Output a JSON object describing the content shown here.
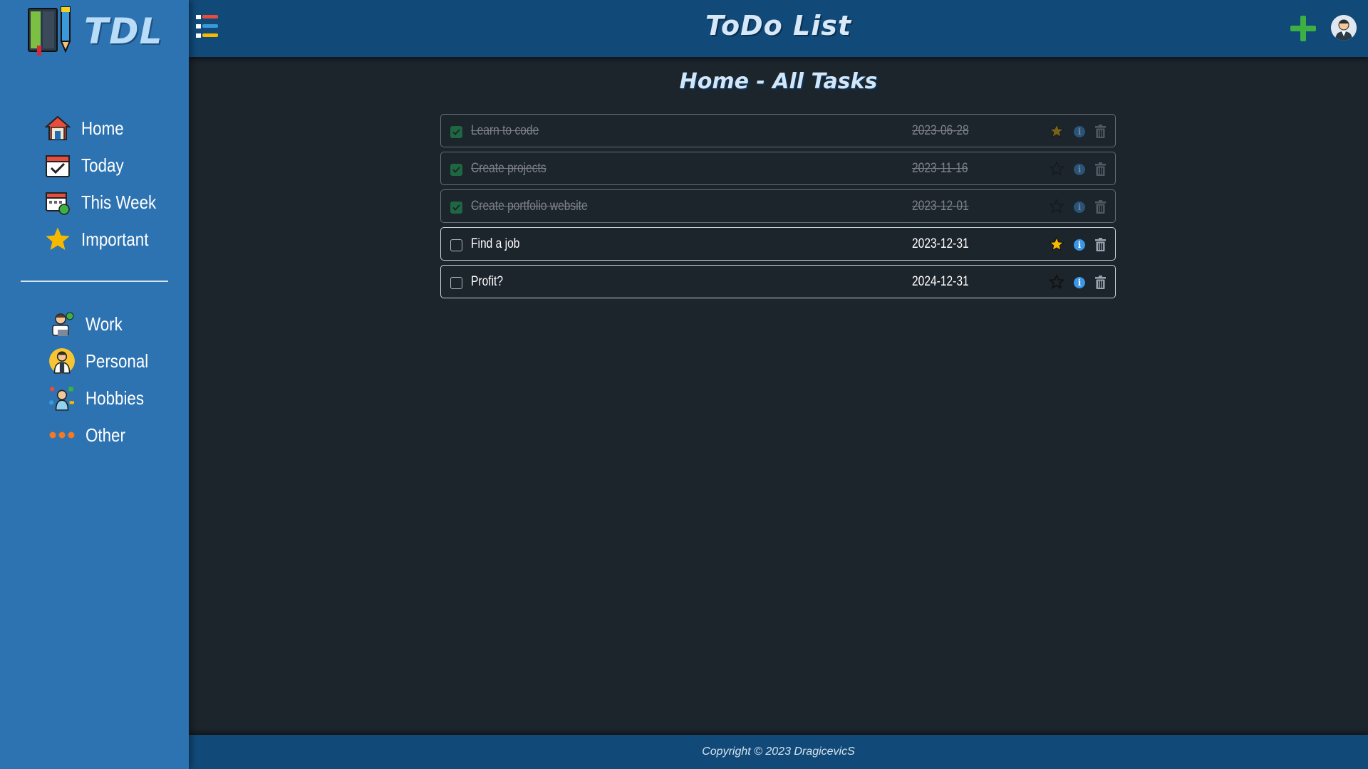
{
  "sidebar": {
    "logo_text": "TDL",
    "nav": [
      {
        "label": "Home",
        "icon": "house-icon"
      },
      {
        "label": "Today",
        "icon": "calendar-check-icon"
      },
      {
        "label": "This Week",
        "icon": "calendar-week-icon"
      },
      {
        "label": "Important",
        "icon": "star-icon"
      }
    ],
    "projects": [
      {
        "label": "Work",
        "icon": "worker-icon"
      },
      {
        "label": "Personal",
        "icon": "person-icon"
      },
      {
        "label": "Hobbies",
        "icon": "hobbies-icon"
      },
      {
        "label": "Other",
        "icon": "dots-icon"
      }
    ]
  },
  "header": {
    "title": "ToDo List"
  },
  "main": {
    "page_title": "Home - All Tasks",
    "tasks": [
      {
        "name": "Learn to code",
        "date": "2023-06-28",
        "done": true,
        "important": true
      },
      {
        "name": "Create projects",
        "date": "2023-11-16",
        "done": true,
        "important": false
      },
      {
        "name": "Create portfolio website",
        "date": "2023-12-01",
        "done": true,
        "important": false
      },
      {
        "name": "Find a job",
        "date": "2023-12-31",
        "done": false,
        "important": true
      },
      {
        "name": "Profit?",
        "date": "2024-12-31",
        "done": false,
        "important": false
      }
    ]
  },
  "footer": {
    "copyright": "Copyright © 2023 DragicevicS"
  },
  "colors": {
    "sidebar": "#2d72b1",
    "header": "#114a78",
    "background": "#1c242c",
    "add": "#3cb043",
    "star": "#f5b900",
    "info": "#3b96e6",
    "done_check": "#22c55e"
  }
}
